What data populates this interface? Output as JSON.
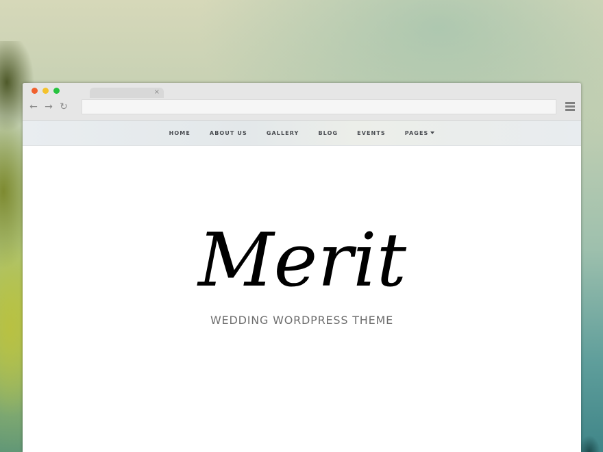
{
  "browser": {
    "window_buttons": [
      {
        "name": "close",
        "color": "#f0612e"
      },
      {
        "name": "minimize",
        "color": "#f4c22c"
      },
      {
        "name": "maximize",
        "color": "#27c33f"
      }
    ],
    "tab_close_symbol": "×",
    "nav": {
      "back_icon": "←",
      "forward_icon": "→",
      "reload_icon": "↻"
    },
    "url_value": "",
    "menu_icon": "hamburger-icon"
  },
  "site_nav": {
    "items": [
      {
        "label": "HOME"
      },
      {
        "label": "ABOUT US"
      },
      {
        "label": "GALLERY"
      },
      {
        "label": "BLOG"
      },
      {
        "label": "EVENTS"
      },
      {
        "label": "PAGES",
        "has_dropdown": true
      }
    ]
  },
  "hero": {
    "logo_text": "Merit",
    "tagline": "WEDDING WORDPRESS THEME"
  }
}
